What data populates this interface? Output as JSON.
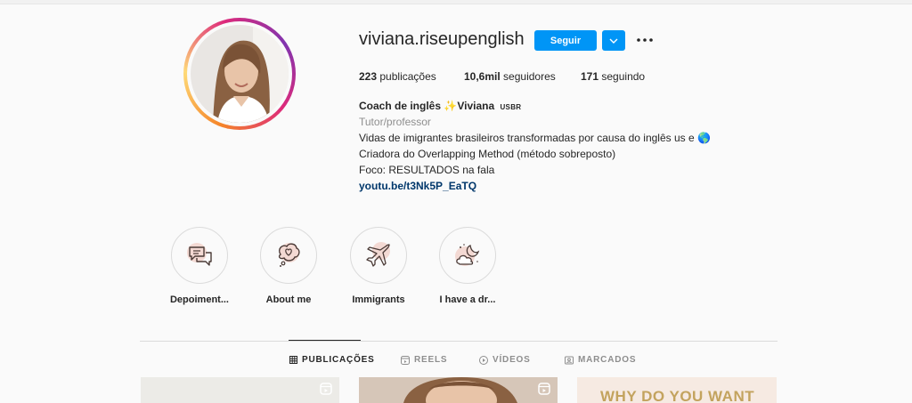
{
  "profile": {
    "username": "viviana.riseupenglish",
    "follow_label": "Seguir",
    "stats": {
      "posts_count": "223",
      "posts_label": "publicações",
      "followers_count": "10,6mil",
      "followers_label": "seguidores",
      "following_count": "171",
      "following_label": "seguindo"
    },
    "bio": {
      "name": "Coach de inglês",
      "name_sparkle": "✨",
      "name_suffix": "Viviana",
      "badge": "USBR",
      "category": "Tutor/professor",
      "line1": "Vidas de imigrantes brasileiros transformadas por causa do inglês us e 🌎",
      "line2": "Criadora do Overlapping Method (método sobreposto)",
      "line3": "Foco: RESULTADOS na fala",
      "link": "youtu.be/t3Nk5P_EaTQ"
    }
  },
  "highlights": [
    {
      "label": "Depoiment...",
      "icon": "chat-bubbles-icon"
    },
    {
      "label": "About me",
      "icon": "heart-bubble-icon"
    },
    {
      "label": "Immigrants",
      "icon": "airplane-icon"
    },
    {
      "label": "I have a dr...",
      "icon": "moon-cloud-icon"
    }
  ],
  "tabs": [
    {
      "label": "PUBLICAÇÕES",
      "icon": "grid-icon",
      "active": true
    },
    {
      "label": "REELS",
      "icon": "reels-icon",
      "active": false
    },
    {
      "label": "VÍDEOS",
      "icon": "play-icon",
      "active": false
    },
    {
      "label": "MARCADOS",
      "icon": "tag-icon",
      "active": false
    }
  ],
  "posts": [
    {
      "text": ""
    },
    {
      "text": ""
    },
    {
      "text": "WHY DO YOU WANT"
    }
  ],
  "colors": {
    "accent": "#0095f6",
    "link": "#00376b",
    "text": "#262626",
    "muted": "#8e8e8e"
  }
}
